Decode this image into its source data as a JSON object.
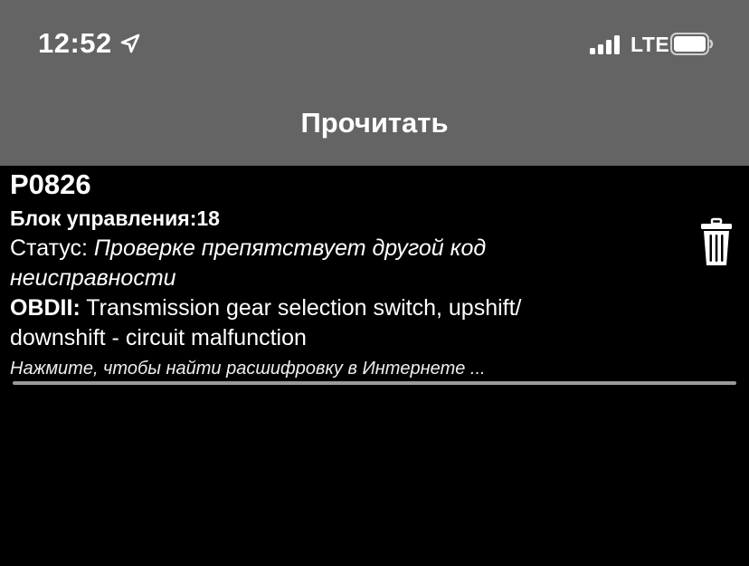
{
  "status_bar": {
    "time": "12:52",
    "network": "LTE",
    "location_icon": "location-arrow-icon",
    "signal_icon": "cellular-signal-icon",
    "battery_icon": "battery-icon"
  },
  "nav": {
    "title": "Прочитать"
  },
  "entry": {
    "code": "P0826",
    "block_label": "Блок управления:",
    "block_value": "18",
    "status_label": "Статус: ",
    "status_line1": "Проверке препятствует другой код",
    "status_line2": "неисправности",
    "obd_label": "OBDII:",
    "obd_line1": " Transmission gear selection switch, upshift/",
    "obd_line2": "downshift - circuit malfunction",
    "hint": "Нажмите, чтобы найти расшифровку в Интернете ...",
    "delete_icon": "trash-icon"
  }
}
